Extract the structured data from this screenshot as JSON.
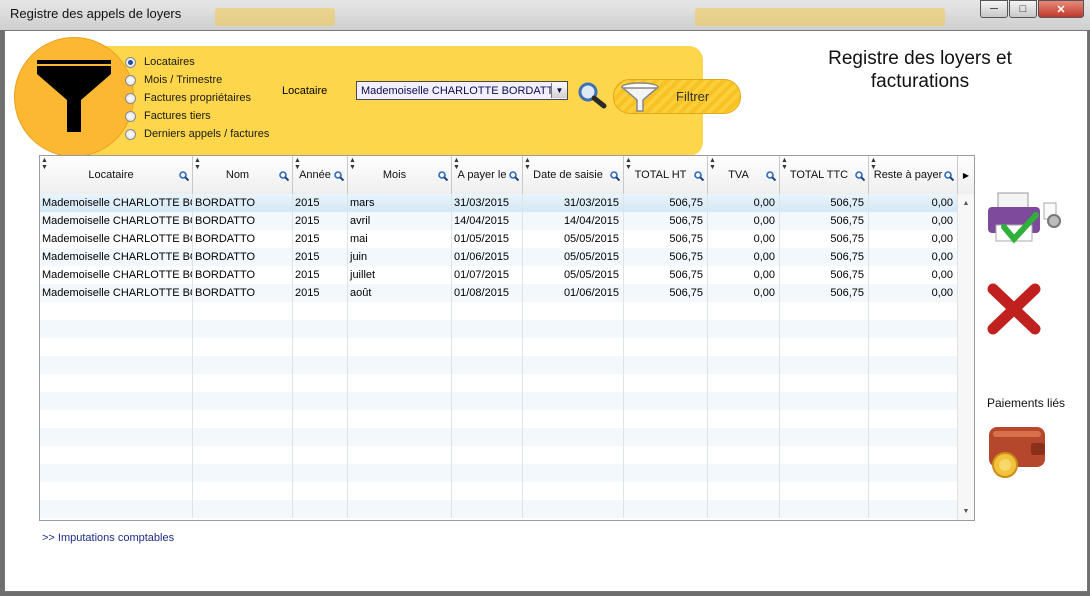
{
  "window": {
    "title": "Registre des appels de loyers",
    "controls": [
      "minimize",
      "maximize",
      "close"
    ]
  },
  "page_title": "Registre des loyers et facturations",
  "filter": {
    "options": [
      {
        "label": "Locataires",
        "selected": true
      },
      {
        "label": "Mois / Trimestre",
        "selected": false
      },
      {
        "label": "Factures propriétaires",
        "selected": false
      },
      {
        "label": "Factures tiers",
        "selected": false
      },
      {
        "label": "Derniers appels / factures",
        "selected": false
      }
    ],
    "locataire_label": "Locataire",
    "locataire_value": "Mademoiselle CHARLOTTE BORDATTO",
    "filter_button": "Filtrer"
  },
  "table": {
    "columns": [
      "Locataire",
      "Nom",
      "Année",
      "Mois",
      "A payer le",
      "Date de saisie",
      "TOTAL HT",
      "TVA",
      "TOTAL TTC",
      "Reste à payer"
    ],
    "rows": [
      [
        "Mademoiselle CHARLOTTE BORDATTO",
        "BORDATTO",
        "2015",
        "mars",
        "31/03/2015",
        "31/03/2015",
        "506,75",
        "0,00",
        "506,75",
        "0,00"
      ],
      [
        "Mademoiselle CHARLOTTE BORDATTO",
        "BORDATTO",
        "2015",
        "avril",
        "14/04/2015",
        "14/04/2015",
        "506,75",
        "0,00",
        "506,75",
        "0,00"
      ],
      [
        "Mademoiselle CHARLOTTE BORDATTO",
        "BORDATTO",
        "2015",
        "mai",
        "01/05/2015",
        "05/05/2015",
        "506,75",
        "0,00",
        "506,75",
        "0,00"
      ],
      [
        "Mademoiselle CHARLOTTE BORDATTO",
        "BORDATTO",
        "2015",
        "juin",
        "01/06/2015",
        "05/05/2015",
        "506,75",
        "0,00",
        "506,75",
        "0,00"
      ],
      [
        "Mademoiselle CHARLOTTE BORDATTO",
        "BORDATTO",
        "2015",
        "juillet",
        "01/07/2015",
        "05/05/2015",
        "506,75",
        "0,00",
        "506,75",
        "0,00"
      ],
      [
        "Mademoiselle CHARLOTTE BORDATTO",
        "BORDATTO",
        "2015",
        "août",
        "01/08/2015",
        "01/06/2015",
        "506,75",
        "0,00",
        "506,75",
        "0,00"
      ]
    ],
    "selected_row": 0
  },
  "links": {
    "imputations": ">> Imputations comptables"
  },
  "side": {
    "paiements_label": "Paiements liés"
  },
  "icons": {
    "funnel": "funnel-icon",
    "search": "magnifier-icon",
    "print": "printer-check-icon",
    "delete": "red-x-icon",
    "wallet": "wallet-coin-icon"
  },
  "colors": {
    "panel": "#fdd64b",
    "circle": "#fcb833",
    "delete": "#c0211f",
    "link": "#1d2c8a"
  }
}
